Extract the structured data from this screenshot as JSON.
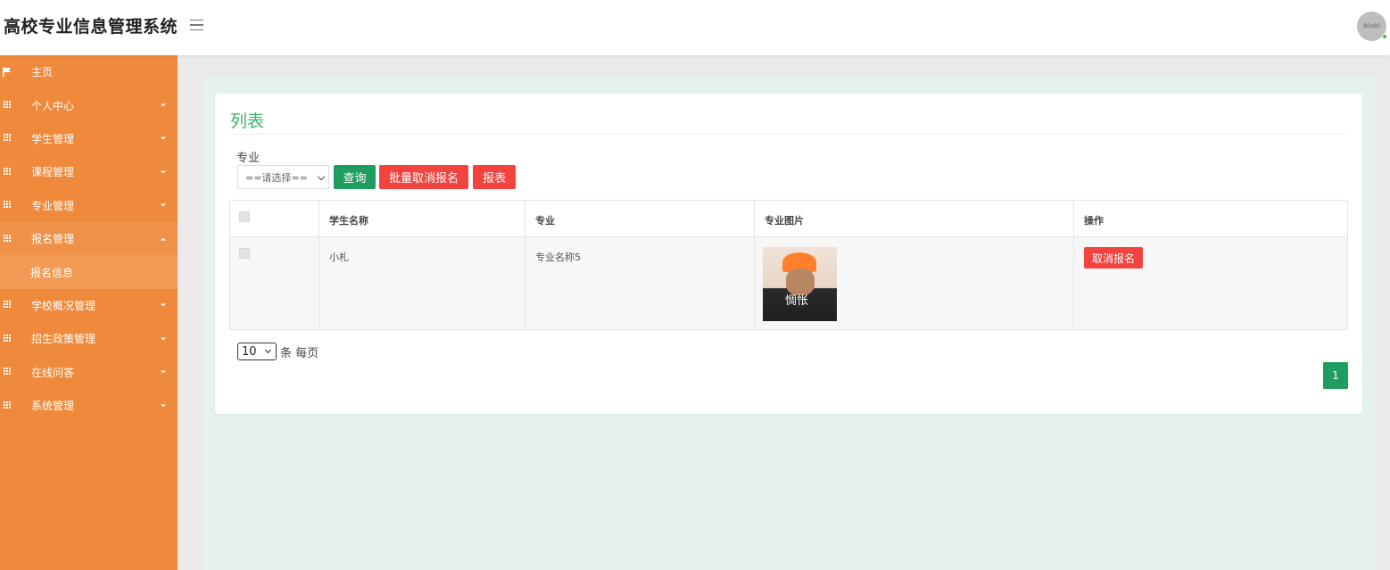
{
  "header": {
    "brand": "高校专业信息管理系统",
    "avatar_text": "80x80"
  },
  "sidebar": {
    "items": [
      {
        "label": "主页",
        "icon": "flag-icon",
        "expandable": false
      },
      {
        "label": "个人中心",
        "icon": "grid-icon",
        "expandable": true
      },
      {
        "label": "学生管理",
        "icon": "grid-icon",
        "expandable": true
      },
      {
        "label": "课程管理",
        "icon": "grid-icon",
        "expandable": true
      },
      {
        "label": "专业管理",
        "icon": "grid-icon",
        "expandable": true
      },
      {
        "label": "报名管理",
        "icon": "grid-icon",
        "expandable": true,
        "expanded": true
      },
      {
        "label": "报名信息",
        "submenu": true
      },
      {
        "label": "学校概况管理",
        "icon": "grid-icon",
        "expandable": true
      },
      {
        "label": "招生政策管理",
        "icon": "grid-icon",
        "expandable": true
      },
      {
        "label": "在线问答",
        "icon": "grid-icon",
        "expandable": true
      },
      {
        "label": "系统管理",
        "icon": "grid-icon",
        "expandable": true
      }
    ]
  },
  "card": {
    "title": "列表",
    "filter": {
      "label": "专业",
      "selected": "==请选择=="
    },
    "buttons": {
      "query": "查询",
      "batch_cancel": "批量取消报名",
      "report": "报表"
    },
    "table": {
      "headers": [
        "学生名称",
        "专业",
        "专业图片",
        "操作"
      ],
      "rows": [
        {
          "student": "小札",
          "major": "专业名称5",
          "image_caption": "惆怅",
          "action": "取消报名"
        }
      ]
    },
    "pagination": {
      "page_size": "10",
      "per_page_text": "条 每页",
      "current_page": "1"
    }
  },
  "colors": {
    "sidebar": "#ef8a3c",
    "title_green": "#3bb36b",
    "primary_green": "#1f9c5f",
    "danger_red": "#f2433f"
  }
}
